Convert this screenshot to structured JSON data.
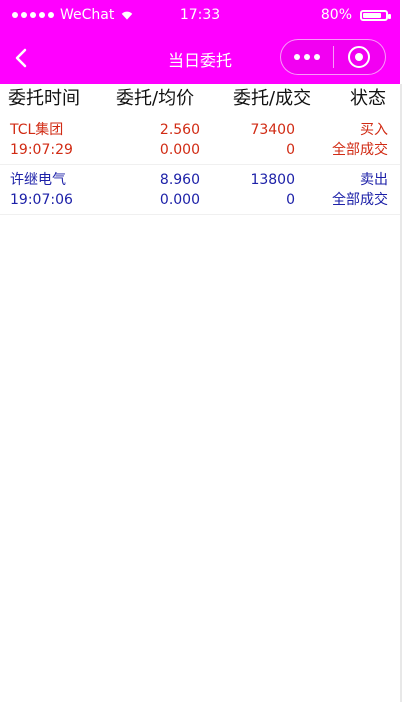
{
  "status_bar": {
    "carrier": "WeChat",
    "time": "17:33",
    "battery": "80%",
    "battery_level": 0.8
  },
  "navbar": {
    "title": "当日委托"
  },
  "table": {
    "headers": [
      "委托时间",
      "委托/均价",
      "委托/成交",
      "状态"
    ],
    "rows": [
      {
        "name": "TCL集团",
        "time": "19:07:29",
        "price": "2.560",
        "avg_price": "0.000",
        "qty": "73400",
        "filled": "0",
        "side": "买入",
        "status": "全部成交",
        "color": "#d12b14"
      },
      {
        "name": "许继电气",
        "time": "19:07:06",
        "price": "8.960",
        "avg_price": "0.000",
        "qty": "13800",
        "filled": "0",
        "side": "卖出",
        "status": "全部成交",
        "color": "#1d21a8"
      }
    ]
  },
  "colors": {
    "accent": "#ff00ff"
  }
}
